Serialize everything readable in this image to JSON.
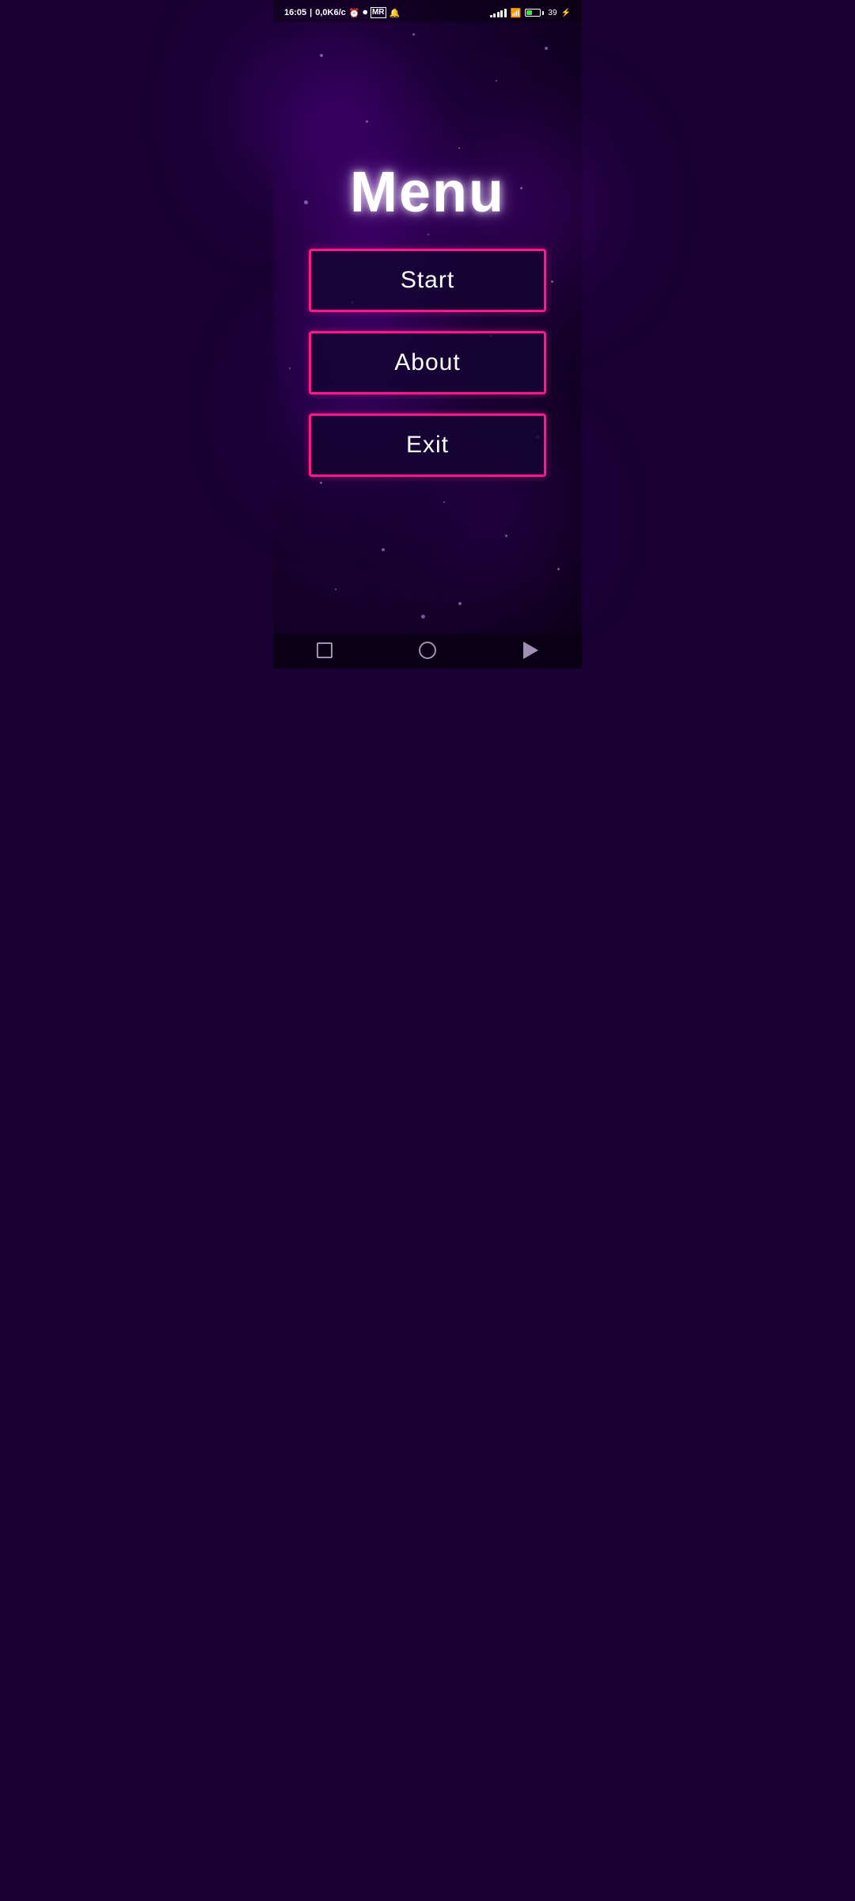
{
  "statusBar": {
    "time": "16:05",
    "data": "0,0K6/c",
    "batteryPercent": "39",
    "colors": {
      "background": "#1a0033",
      "accent": "#ff1a8c",
      "buttonBorder": "#ff1a8c",
      "titleColor": "#ffffff",
      "buttonText": "#ffffff"
    }
  },
  "menu": {
    "title": "Menu",
    "buttons": [
      {
        "label": "Start",
        "id": "start"
      },
      {
        "label": "About",
        "id": "about"
      },
      {
        "label": "Exit",
        "id": "exit"
      }
    ]
  },
  "navbar": {
    "squareLabel": "recent-apps",
    "circleLabel": "home",
    "triangleLabel": "back"
  }
}
